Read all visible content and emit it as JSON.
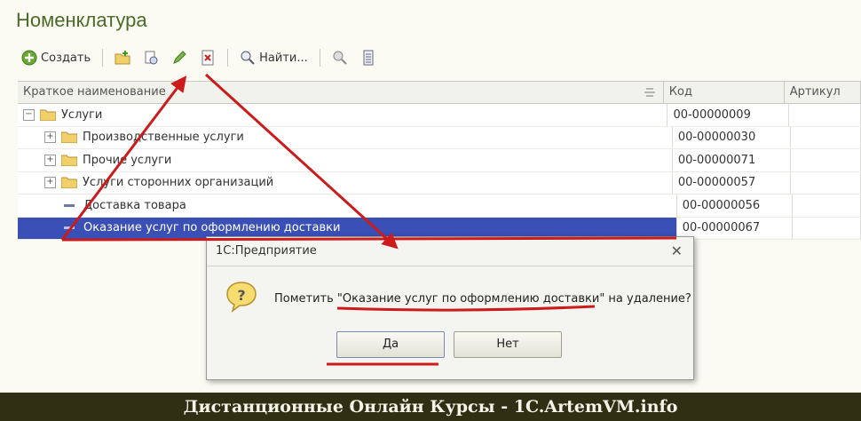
{
  "window": {
    "title": "Номенклатура"
  },
  "toolbar": {
    "create_label": "Создать",
    "find_label": "Найти..."
  },
  "grid": {
    "columns": [
      "Краткое наименование",
      "Код",
      "Артикул"
    ],
    "rows": [
      {
        "name": "Услуги",
        "code": "00-00000009"
      },
      {
        "name": "Производственные услуги",
        "code": "00-00000030"
      },
      {
        "name": "Прочие услуги",
        "code": "00-00000071"
      },
      {
        "name": "Услуги сторонних организаций",
        "code": "00-00000057"
      },
      {
        "name": "Доставка товара",
        "code": "00-00000056"
      },
      {
        "name": "Оказание услуг по оформлению доставки",
        "code": "00-00000067"
      }
    ]
  },
  "dialog": {
    "title": "1С:Предприятие",
    "message_prefix": "Пометить \"",
    "message_item": "Оказание услуг по оформлению доставки",
    "message_suffix": "\" на удаление?",
    "yes_label": "Да",
    "no_label": "Нет"
  },
  "footer": {
    "text": "Дистанционные Онлайн Курсы - 1C.ArtemVM.info"
  },
  "colors": {
    "selection": "#3a50b6",
    "annotation": "#cc1b1b",
    "title": "#4a6a28"
  }
}
